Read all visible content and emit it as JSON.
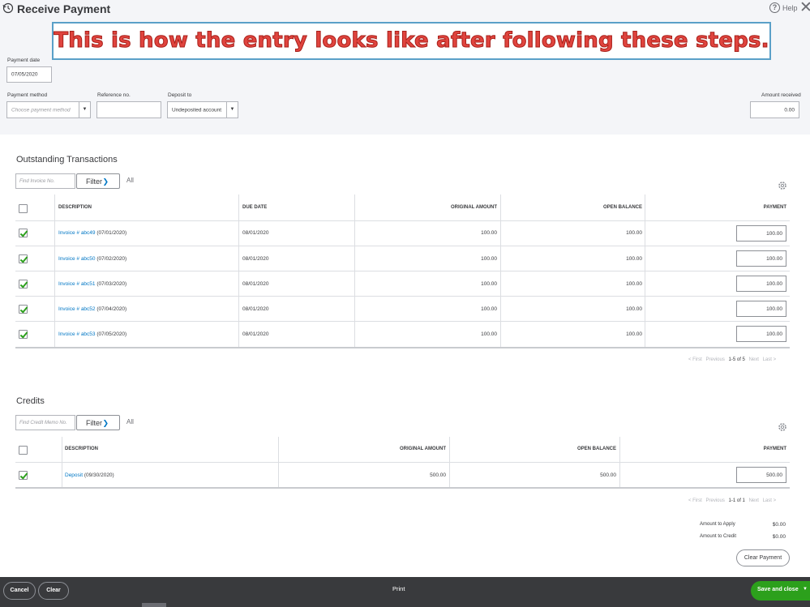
{
  "header": {
    "title": "Receive Payment",
    "help_label": "Help",
    "help_glyph": "?",
    "close_glyph": "✕"
  },
  "banner": {
    "text": "This is how the entry looks like after following these steps.",
    "text_color": "#e0443e",
    "border_color": "#5aa0c8"
  },
  "form": {
    "payment_date_label": "Payment date",
    "payment_date_value": "07/05/2020",
    "payment_method_label": "Payment method",
    "payment_method_placeholder": "Choose payment method",
    "reference_label": "Reference no.",
    "reference_value": "",
    "deposit_to_label": "Deposit to",
    "deposit_to_value": "Undeposited account",
    "amount_received_label": "Amount received",
    "amount_received_value": "0.00",
    "dropdown_glyph": "▼"
  },
  "outstanding": {
    "title": "Outstanding Transactions",
    "search_placeholder": "Find Invoice No.",
    "filter_label": "Filter",
    "filter_chevron": "❯",
    "all_label": "All",
    "columns": [
      "DESCRIPTION",
      "DUE DATE",
      "ORIGINAL AMOUNT",
      "OPEN BALANCE",
      "PAYMENT"
    ],
    "rows": [
      {
        "link": "Invoice # abc49",
        "date_text": " (07/01/2020)",
        "due": "08/01/2020",
        "original": "100.00",
        "open": "100.00",
        "payment": "100.00",
        "checked": true
      },
      {
        "link": "Invoice # abc50",
        "date_text": " (07/02/2020)",
        "due": "08/01/2020",
        "original": "100.00",
        "open": "100.00",
        "payment": "100.00",
        "checked": true
      },
      {
        "link": "Invoice # abc51",
        "date_text": " (07/03/2020)",
        "due": "08/01/2020",
        "original": "100.00",
        "open": "100.00",
        "payment": "100.00",
        "checked": true
      },
      {
        "link": "Invoice # abc52",
        "date_text": " (07/04/2020)",
        "due": "08/01/2020",
        "original": "100.00",
        "open": "100.00",
        "payment": "100.00",
        "checked": true
      },
      {
        "link": "Invoice # abc53",
        "date_text": " (07/05/2020)",
        "due": "08/01/2020",
        "original": "100.00",
        "open": "100.00",
        "payment": "100.00",
        "checked": true
      }
    ],
    "pager": {
      "first": "< First",
      "previous": "Previous",
      "current": "1-5 of 5",
      "next": "Next",
      "last": "Last >"
    }
  },
  "credits": {
    "title": "Credits",
    "search_placeholder": "Find Credit Memo No.",
    "filter_label": "Filter",
    "filter_chevron": "❯",
    "all_label": "All",
    "columns": [
      "DESCRIPTION",
      "ORIGINAL AMOUNT",
      "OPEN BALANCE",
      "PAYMENT"
    ],
    "rows": [
      {
        "link": "Deposit",
        "date_text": " (09/30/2020)",
        "original": "500.00",
        "open": "500.00",
        "payment": "500.00",
        "checked": true
      }
    ],
    "pager": {
      "first": "< First",
      "previous": "Previous",
      "current": "1-1 of 1",
      "next": "Next",
      "last": "Last >"
    }
  },
  "totals": {
    "apply_label": "Amount to Apply",
    "apply_value": "$0.00",
    "credit_label": "Amount to Credit",
    "credit_value": "$0.00",
    "clear_payment_label": "Clear Payment"
  },
  "footer": {
    "cancel_label": "Cancel",
    "clear_label": "Clear",
    "print_label": "Print",
    "save_label": "Save and close",
    "save_dropdown_glyph": "▼",
    "accent": "#2ca01c"
  }
}
